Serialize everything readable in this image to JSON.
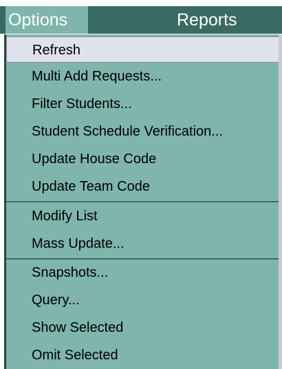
{
  "menubar": {
    "options_label": "Options",
    "reports_label": "Reports"
  },
  "menu": {
    "items": [
      {
        "label": "Refresh",
        "highlighted": true
      },
      {
        "label": "Multi Add Requests..."
      },
      {
        "label": "Filter Students..."
      },
      {
        "label": "Student Schedule Verification..."
      },
      {
        "label": "Update House Code"
      },
      {
        "label": "Update Team Code"
      },
      {
        "label": "Modify List"
      },
      {
        "label": "Mass Update..."
      },
      {
        "label": "Snapshots..."
      },
      {
        "label": "Query..."
      },
      {
        "label": "Show Selected"
      },
      {
        "label": "Omit Selected"
      }
    ]
  },
  "colors": {
    "menubar_bg": "#3a6b63",
    "menu_bg": "#7fb5ac",
    "highlight_bg": "#dfe2ea"
  }
}
